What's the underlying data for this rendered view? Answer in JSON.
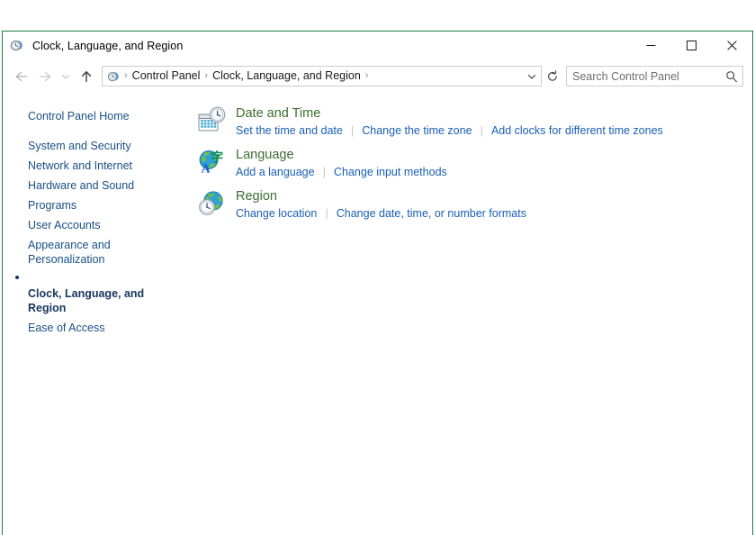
{
  "window": {
    "title": "Clock, Language, and Region",
    "icon": "clock-region-icon",
    "border_color": "#1b7f47",
    "caption": {
      "minimize_label": "Minimize",
      "maximize_label": "Maximize",
      "close_label": "Close"
    }
  },
  "navigation": {
    "back_label": "Back",
    "forward_label": "Forward",
    "recent_label": "Recent locations",
    "up_label": "Up one level",
    "breadcrumb": {
      "icon": "control-panel-icon",
      "items": [
        "Control Panel",
        "Clock, Language, and Region"
      ],
      "separator": "›",
      "trailing_separator": "›"
    },
    "dropdown_label": "Previous locations",
    "refresh_label": "Refresh"
  },
  "search": {
    "placeholder": "Search Control Panel",
    "value": "",
    "icon": "search-icon"
  },
  "sidebar": {
    "home": "Control Panel Home",
    "items": [
      {
        "label": "System and Security",
        "current": false
      },
      {
        "label": "Network and Internet",
        "current": false
      },
      {
        "label": "Hardware and Sound",
        "current": false
      },
      {
        "label": "Programs",
        "current": false
      },
      {
        "label": "User Accounts",
        "current": false
      },
      {
        "label": "Appearance and\nPersonalization",
        "current": false
      },
      {
        "label": "Clock, Language, and Region",
        "current": true
      },
      {
        "label": "Ease of Access",
        "current": false
      }
    ]
  },
  "main": {
    "categories": [
      {
        "title": "Date and Time",
        "icon": "date-and-time-icon",
        "links": [
          "Set the time and date",
          "Change the time zone",
          "Add clocks for different time zones"
        ]
      },
      {
        "title": "Language",
        "icon": "language-icon",
        "links": [
          "Add a language",
          "Change input methods"
        ]
      },
      {
        "title": "Region",
        "icon": "region-icon",
        "links": [
          "Change location",
          "Change date, time, or number formats"
        ]
      }
    ]
  },
  "colors": {
    "category_title": "#3b6f2e",
    "link": "#1a5fb4",
    "sidebar_link": "#1a4f87",
    "sidebar_current": "#17375e",
    "window_border": "#1b7f47"
  }
}
